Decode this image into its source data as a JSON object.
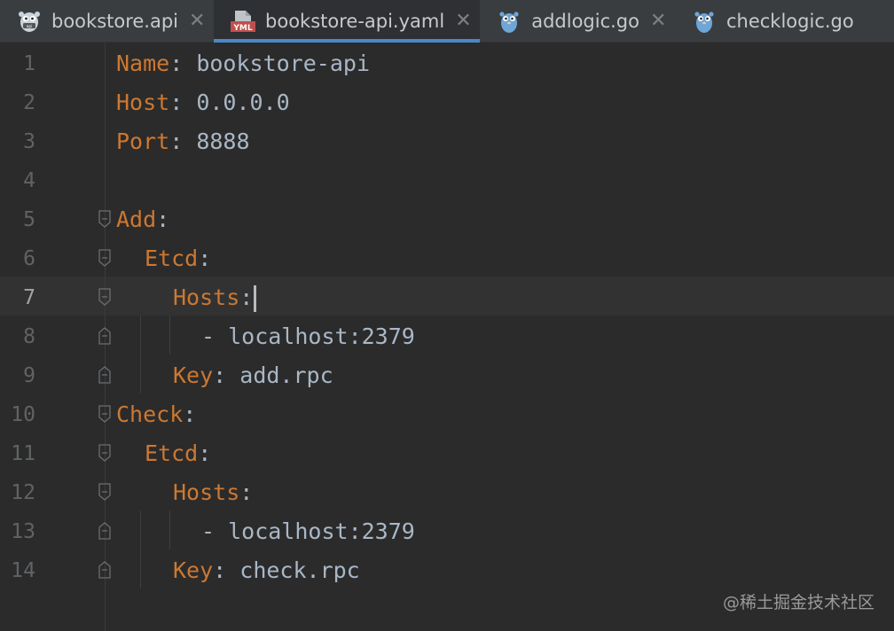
{
  "tabs": [
    {
      "label": "bookstore.api",
      "icon": "gopher-api-icon",
      "active": false
    },
    {
      "label": "bookstore-api.yaml",
      "icon": "yaml-file-icon",
      "icon_text": "YML",
      "active": true
    },
    {
      "label": "addlogic.go",
      "icon": "gopher-icon",
      "active": false
    },
    {
      "label": "checklogic.go",
      "icon": "gopher-icon",
      "active": false
    }
  ],
  "editor": {
    "current_line": 7,
    "lines": [
      {
        "no": "1",
        "key": "Name",
        "sep": ": ",
        "value": "bookstore-api",
        "indent": 0
      },
      {
        "no": "2",
        "key": "Host",
        "sep": ": ",
        "value": "0.0.0.0",
        "indent": 0
      },
      {
        "no": "3",
        "key": "Port",
        "sep": ": ",
        "value": "8888",
        "indent": 0
      },
      {
        "no": "4",
        "key": "",
        "sep": "",
        "value": "",
        "indent": 0
      },
      {
        "no": "5",
        "key": "Add",
        "sep": ":",
        "value": "",
        "indent": 0
      },
      {
        "no": "6",
        "key": "Etcd",
        "sep": ":",
        "value": "",
        "indent": 1
      },
      {
        "no": "7",
        "key": "Hosts",
        "sep": ":",
        "value": "",
        "indent": 2
      },
      {
        "no": "8",
        "key": "",
        "sep": "",
        "value": "- localhost:2379",
        "indent": 3
      },
      {
        "no": "9",
        "key": "Key",
        "sep": ": ",
        "value": "add.rpc",
        "indent": 2
      },
      {
        "no": "10",
        "key": "Check",
        "sep": ":",
        "value": "",
        "indent": 0
      },
      {
        "no": "11",
        "key": "Etcd",
        "sep": ":",
        "value": "",
        "indent": 1
      },
      {
        "no": "12",
        "key": "Hosts",
        "sep": ":",
        "value": "",
        "indent": 2
      },
      {
        "no": "13",
        "key": "",
        "sep": "",
        "value": "- localhost:2379",
        "indent": 3
      },
      {
        "no": "14",
        "key": "Key",
        "sep": ": ",
        "value": "check.rpc",
        "indent": 2
      }
    ]
  },
  "watermark": "@稀土掘金技术社区",
  "colors": {
    "key": "#cc7832",
    "text": "#a9b7c6",
    "background": "#2b2b2b",
    "tab_accent": "#4a88c7"
  }
}
